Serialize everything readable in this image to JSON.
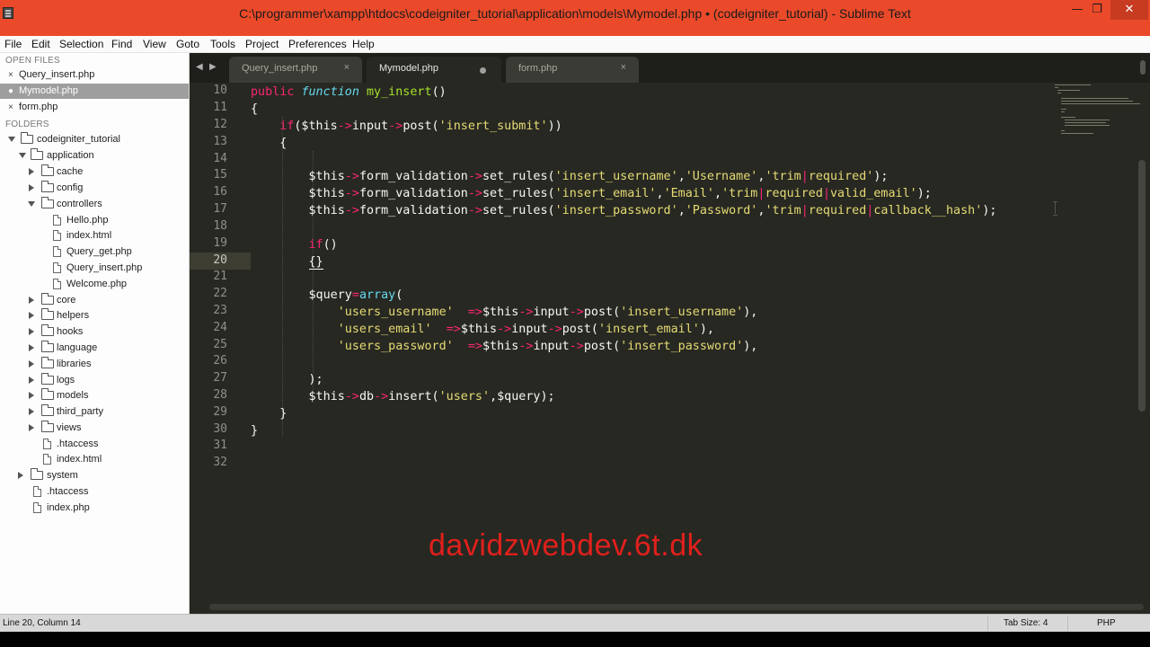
{
  "window": {
    "title": "C:\\programmer\\xampp\\htdocs\\codeigniter_tutorial\\application\\models\\Mymodel.php • (codeigniter_tutorial) - Sublime Text",
    "minimize_glyph": "—",
    "restore_glyph": "❐",
    "close_glyph": "✕"
  },
  "menu": [
    "File",
    "Edit",
    "Selection",
    "Find",
    "View",
    "Goto",
    "Tools",
    "Project",
    "Preferences",
    "Help"
  ],
  "sidebar": {
    "open_files_heading": "OPEN FILES",
    "open_files": [
      "Query_insert.php",
      "Mymodel.php",
      "form.php"
    ],
    "folders_heading": "FOLDERS",
    "tree": [
      "codeigniter_tutorial",
      "application",
      "cache",
      "config",
      "controllers",
      "Hello.php",
      "index.html",
      "Query_get.php",
      "Query_insert.php",
      "Welcome.php",
      "core",
      "helpers",
      "hooks",
      "language",
      "libraries",
      "logs",
      "models",
      "third_party",
      "views",
      ".htaccess",
      "index.html",
      "system",
      ".htaccess",
      "index.php"
    ]
  },
  "tabs": [
    {
      "label": "Query_insert.php",
      "close": "×"
    },
    {
      "label": "Mymodel.php"
    },
    {
      "label": "form.php",
      "close": "×"
    }
  ],
  "tab_nav": {
    "left": "◀",
    "right": "▶"
  },
  "editor": {
    "line_numbers": [
      "10",
      "11",
      "12",
      "13",
      "14",
      "15",
      "16",
      "17",
      "18",
      "19",
      "20",
      "21",
      "22",
      "23",
      "24",
      "25",
      "26",
      "27",
      "28",
      "29",
      "30",
      "31",
      "32"
    ],
    "current_line": "20"
  },
  "watermark": "davidzwebdev.6t.dk",
  "status": {
    "position": "Line 20, Column 14",
    "tab_size": "Tab Size: 4",
    "syntax": "PHP"
  },
  "colors": {
    "title_bar": "#eb4a2a",
    "editor_bg": "#272822",
    "keyword": "#f92672",
    "function": "#a6e22e",
    "string": "#e6db74",
    "storage": "#66d9ef",
    "watermark": "#e0201c"
  }
}
